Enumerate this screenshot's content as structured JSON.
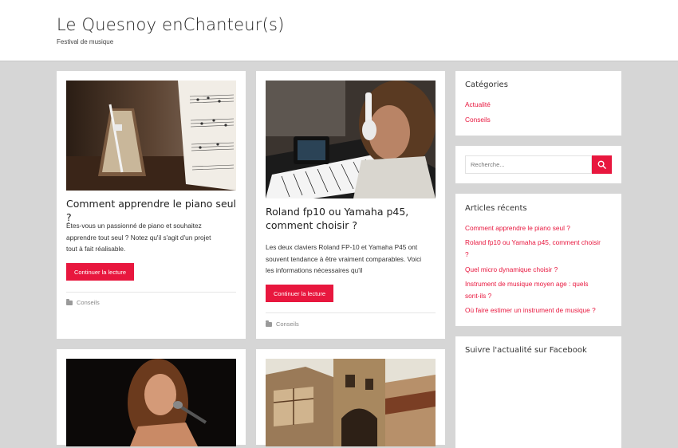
{
  "site": {
    "title": "Le Quesnoy enChanteur(s)",
    "description": "Festival de musique"
  },
  "posts": [
    {
      "title": "Comment apprendre le piano seul ?",
      "excerpt_lines": [
        "Êtes-vous un passionné de piano et souhaitez",
        "apprendre tout seul ? Notez qu'il s'agit d'un projet",
        "tout à fait réalisable."
      ],
      "button": "Continuer la lecture",
      "category": "Conseils",
      "image": "metronome-sheet-music-photo"
    },
    {
      "title_lines": [
        "Roland fp10 ou Yamaha p45,",
        "comment choisir ?"
      ],
      "excerpt_lines": [
        "Les deux claviers Roland FP-10 et Yamaha P45 ont",
        "souvent tendance à être vraiment comparables. Voici",
        "les informations nécessaires qu'il"
      ],
      "button": "Continuer la lecture",
      "category": "Conseils",
      "image": "woman-headphones-keyboard-photo"
    },
    {
      "image": "singer-microphone-photo"
    },
    {
      "image": "medieval-castle-photo"
    }
  ],
  "sidebar": {
    "categories": {
      "title": "Catégories",
      "items": [
        "Actualité",
        "Conseils"
      ]
    },
    "search": {
      "placeholder": "Recherche..."
    },
    "recent": {
      "title": "Articles récents",
      "items": [
        [
          "Comment apprendre le piano seul ?"
        ],
        [
          "Roland fp10 ou Yamaha p45, comment choisir",
          "?"
        ],
        [
          "Quel micro dynamique choisir ?"
        ],
        [
          "Instrument de musique moyen age : quels",
          "sont-ils ?"
        ],
        [
          "Où faire estimer un instrument de musique ?"
        ]
      ]
    },
    "facebook": {
      "title": "Suivre l'actualité sur Facebook"
    }
  },
  "colors": {
    "accent": "#e8173e",
    "background": "#d6d6d6"
  }
}
